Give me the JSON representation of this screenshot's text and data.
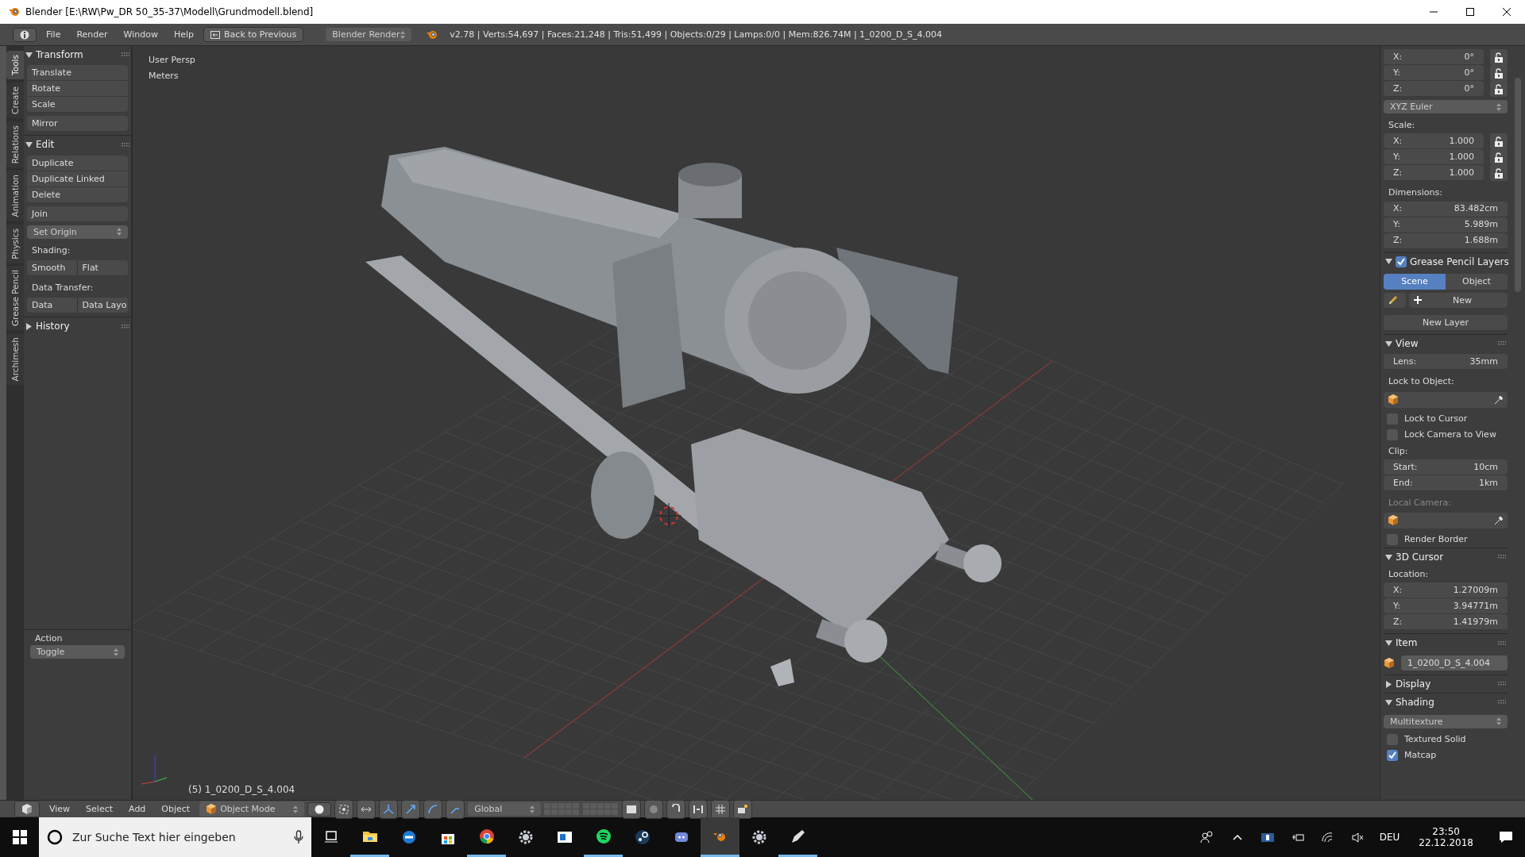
{
  "window": {
    "title": "Blender [E:\\RW\\Pw_DR 50_35-37\\Modell\\Grundmodell.blend]"
  },
  "info_header": {
    "menus": [
      "File",
      "Render",
      "Window",
      "Help"
    ],
    "back_button": "Back to Previous",
    "engine": "Blender Render",
    "stats": "v2.78 | Verts:54,697 | Faces:21,248 | Tris:51,499 | Objects:0/29 | Lamps:0/0 | Mem:826.74M | 1_0200_D_S_4.004"
  },
  "tool_tabs": [
    {
      "label": "Tools",
      "selected": true
    },
    {
      "label": "Create",
      "selected": false
    },
    {
      "label": "Relations",
      "selected": false
    },
    {
      "label": "Animation",
      "selected": false
    },
    {
      "label": "Physics",
      "selected": false
    },
    {
      "label": "Grease Pencil",
      "selected": false
    },
    {
      "label": "Archimesh",
      "selected": false
    }
  ],
  "tool_panels": [
    {
      "title": "Transform",
      "expanded": true,
      "rows": [
        {
          "kind": "group",
          "buttons": [
            "Translate",
            "Rotate",
            "Scale"
          ]
        },
        {
          "kind": "group",
          "buttons": [
            "Mirror"
          ]
        }
      ]
    },
    {
      "title": "Edit",
      "expanded": true,
      "rows": [
        {
          "kind": "group",
          "buttons": [
            "Duplicate",
            "Duplicate Linked",
            "Delete"
          ]
        },
        {
          "kind": "group",
          "buttons": [
            "Join"
          ]
        },
        {
          "kind": "dropdown",
          "value": "Set Origin"
        },
        {
          "kind": "label",
          "text": "Shading:"
        },
        {
          "kind": "pair",
          "buttons": [
            "Smooth",
            "Flat"
          ]
        },
        {
          "kind": "label",
          "text": "Data Transfer:"
        },
        {
          "kind": "pair",
          "buttons": [
            "Data",
            "Data Layo"
          ]
        }
      ]
    },
    {
      "title": "History",
      "expanded": false
    }
  ],
  "operator_panel": {
    "title": "Action",
    "value": "Toggle"
  },
  "viewport": {
    "overlay": [
      "User Persp",
      "Meters"
    ],
    "object_label": "(5) 1_0200_D_S_4.004"
  },
  "properties": [
    {
      "kind": "vector",
      "locks": true,
      "fields": [
        {
          "label": "X:",
          "value": "0°"
        },
        {
          "label": "Y:",
          "value": "0°"
        },
        {
          "label": "Z:",
          "value": "0°"
        }
      ]
    },
    {
      "kind": "dropdown",
      "value": "XYZ Euler"
    },
    {
      "kind": "label",
      "text": "Scale:"
    },
    {
      "kind": "vector",
      "locks": true,
      "fields": [
        {
          "label": "X:",
          "value": "1.000"
        },
        {
          "label": "Y:",
          "value": "1.000"
        },
        {
          "label": "Z:",
          "value": "1.000"
        }
      ]
    },
    {
      "kind": "label",
      "text": "Dimensions:"
    },
    {
      "kind": "vector",
      "locks": false,
      "fields": [
        {
          "label": "X:",
          "value": "83.482cm"
        },
        {
          "label": "Y:",
          "value": "5.989m"
        },
        {
          "label": "Z:",
          "value": "1.688m"
        }
      ]
    },
    {
      "kind": "header",
      "title": "Grease Pencil Layers",
      "expanded": true,
      "checked": true
    },
    {
      "kind": "segmented",
      "options": [
        {
          "label": "Scene",
          "selected": true
        },
        {
          "label": "Object",
          "selected": false
        }
      ]
    },
    {
      "kind": "new",
      "text": "New"
    },
    {
      "kind": "button",
      "text": "New Layer"
    },
    {
      "kind": "header",
      "title": "View",
      "expanded": true
    },
    {
      "kind": "vector",
      "locks": false,
      "fields": [
        {
          "label": "Lens:",
          "value": "35mm"
        }
      ]
    },
    {
      "kind": "label",
      "text": "Lock to Object:"
    },
    {
      "kind": "object_field"
    },
    {
      "kind": "checkbox",
      "text": "Lock to Cursor",
      "checked": false
    },
    {
      "kind": "checkbox",
      "text": "Lock Camera to View",
      "checked": false
    },
    {
      "kind": "label",
      "text": "Clip:"
    },
    {
      "kind": "vector",
      "locks": false,
      "fields": [
        {
          "label": "Start:",
          "value": "10cm"
        },
        {
          "label": "End:",
          "value": "1km"
        }
      ]
    },
    {
      "kind": "label",
      "text": "Local Camera:",
      "disabled": true
    },
    {
      "kind": "object_field"
    },
    {
      "kind": "checkbox",
      "text": "Render Border",
      "checked": false
    },
    {
      "kind": "header",
      "title": "3D Cursor",
      "expanded": true
    },
    {
      "kind": "label",
      "text": "Location:"
    },
    {
      "kind": "vector",
      "locks": false,
      "fields": [
        {
          "label": "X:",
          "value": "1.27009m"
        },
        {
          "label": "Y:",
          "value": "3.94771m"
        },
        {
          "label": "Z:",
          "value": "1.41979m"
        }
      ]
    },
    {
      "kind": "header",
      "title": "Item",
      "expanded": true
    },
    {
      "kind": "item_name",
      "value": "1_0200_D_S_4.004"
    },
    {
      "kind": "header",
      "title": "Display",
      "expanded": false
    },
    {
      "kind": "header",
      "title": "Shading",
      "expanded": true
    },
    {
      "kind": "dropdown",
      "value": "Multitexture"
    },
    {
      "kind": "checkbox",
      "text": "Textured Solid",
      "checked": false
    },
    {
      "kind": "checkbox",
      "text": "Matcap",
      "checked": true
    }
  ],
  "view3d_header": {
    "menus": [
      "View",
      "Select",
      "Add",
      "Object"
    ],
    "mode": "Object Mode",
    "orientation": "Global"
  },
  "taskbar": {
    "search_placeholder": "Zur Suche Text hier eingeben",
    "apps": [
      {
        "kind": "taskview",
        "running": false,
        "selected": false
      },
      {
        "kind": "folder",
        "running": true,
        "selected": false
      },
      {
        "kind": "edge",
        "running": false,
        "selected": false
      },
      {
        "kind": "store",
        "running": false,
        "selected": false
      },
      {
        "kind": "chrome",
        "running": true,
        "selected": false
      },
      {
        "kind": "gear",
        "running": false,
        "selected": false
      },
      {
        "kind": "window",
        "running": false,
        "selected": false
      },
      {
        "kind": "spotify",
        "running": true,
        "selected": false
      },
      {
        "kind": "steam",
        "running": false,
        "selected": false
      },
      {
        "kind": "discord",
        "running": false,
        "selected": false
      },
      {
        "kind": "blender",
        "running": true,
        "selected": true
      },
      {
        "kind": "gear",
        "running": false,
        "selected": false
      },
      {
        "kind": "pen",
        "running": true,
        "selected": false
      }
    ],
    "language": "DEU",
    "time": "23:50",
    "date": "22.12.2018"
  }
}
